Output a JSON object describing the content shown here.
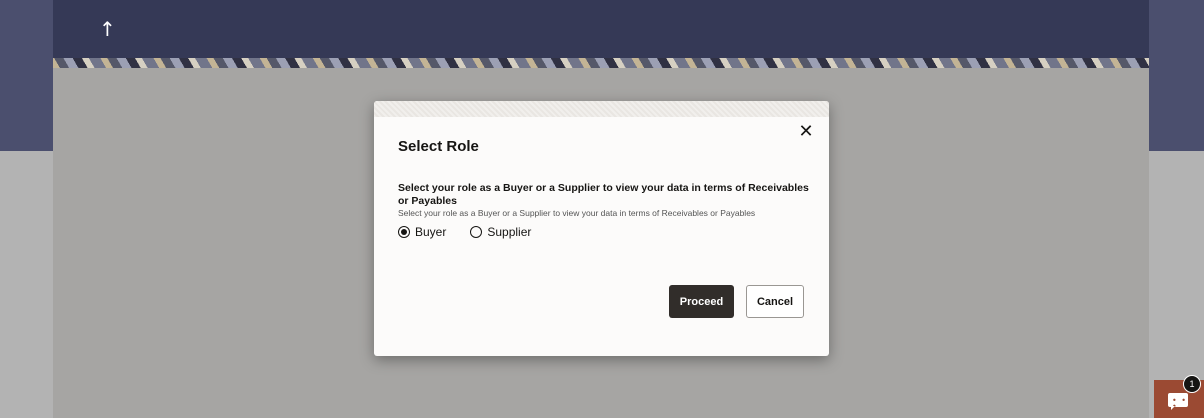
{
  "header": {
    "up_icon": "arrow-up-icon"
  },
  "dialog": {
    "title": "Select Role",
    "close_icon": "close-icon",
    "description": "Select your role as a Buyer or a Supplier to view your data in terms of Receivables or Payables",
    "description_sub": "Select your role as a Buyer or a Supplier to view your data in terms of Receivables or Payables",
    "options": [
      {
        "label": "Buyer",
        "selected": true
      },
      {
        "label": "Supplier",
        "selected": false
      }
    ],
    "proceed_label": "Proceed",
    "cancel_label": "Cancel"
  },
  "chat": {
    "icon": "chat-icon",
    "badge_count": "1"
  },
  "colors": {
    "header": "#353956",
    "primary_button": "#312d2a",
    "chat": "#9b4a33"
  }
}
